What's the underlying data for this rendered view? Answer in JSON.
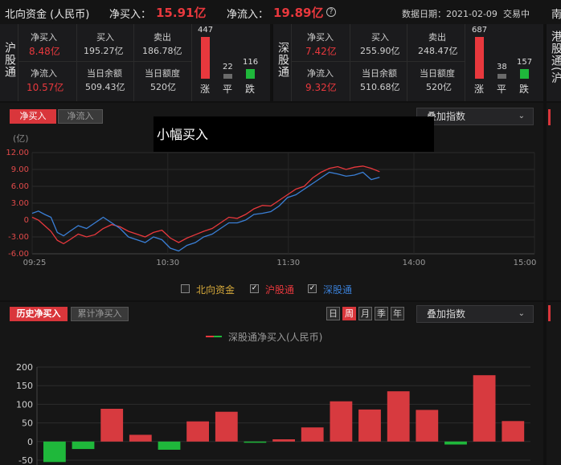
{
  "header": {
    "title": "北向资金 (人民币)",
    "net_buy_label": "净买入：",
    "net_buy_value": "15.91亿",
    "net_inflow_label": "净流入：",
    "net_inflow_value": "19.89亿",
    "help_icon": "?",
    "date_label": "数据日期：2021-02-09",
    "trade_label": "交易中",
    "right_edge": "南"
  },
  "hu": {
    "name": "沪股通",
    "net_buy_label": "净买入",
    "net_buy": "8.48亿",
    "buy_label": "买入",
    "buy": "195.27亿",
    "sell_label": "卖出",
    "sell": "186.78亿",
    "net_inflow_label": "净流入",
    "net_inflow": "10.57亿",
    "balance_label": "当日余额",
    "balance": "509.43亿",
    "quota_label": "当日额度",
    "quota": "520亿",
    "up": "447",
    "flat": "22",
    "down": "116",
    "up_label": "涨",
    "flat_label": "平",
    "down_label": "跌"
  },
  "shen": {
    "name": "深股通",
    "net_buy_label": "净买入",
    "net_buy": "7.42亿",
    "buy_label": "买入",
    "buy": "255.90亿",
    "sell_label": "卖出",
    "sell": "248.47亿",
    "net_inflow_label": "净流入",
    "net_inflow": "9.32亿",
    "balance_label": "当日余额",
    "balance": "510.68亿",
    "quota_label": "当日额度",
    "quota": "520亿",
    "up": "687",
    "flat": "38",
    "down": "157",
    "up_label": "涨",
    "flat_label": "平",
    "down_label": "跌"
  },
  "right_partial": {
    "name": "港股通(沪"
  },
  "intraday": {
    "tab_net_buy": "净买入",
    "tab_net_inflow": "净流入",
    "overlay_select": "叠加指数",
    "tooltip": "小幅买入",
    "unit": "(亿)",
    "legend": {
      "north": "北向资金",
      "hu": "沪股通",
      "shen": "深股通"
    }
  },
  "history": {
    "tab_history": "历史净买入",
    "tab_cumulative": "累计净买入",
    "periods": [
      "日",
      "周",
      "月",
      "季",
      "年"
    ],
    "active_period": "周",
    "overlay_select": "叠加指数",
    "legend_label": "深股通净买入(人民币)"
  },
  "colors": {
    "up": "#e8383d",
    "down": "#1fb83b",
    "hu_line": "#e8383d",
    "shen_line": "#3a7fd6"
  },
  "chart_data": [
    {
      "type": "line",
      "x_ticks": [
        "09:25",
        "10:30",
        "11:30",
        "14:00",
        "15:00"
      ],
      "y_ticks": [
        "12.00",
        "9.00",
        "6.00",
        "3.00",
        "0",
        "-3.00",
        "-6.00"
      ],
      "ylim": [
        -6,
        12
      ],
      "ylabel": "(亿)",
      "grid": true,
      "series": [
        {
          "name": "沪股通",
          "color": "#e8383d",
          "points": [
            [
              0,
              0.5
            ],
            [
              3,
              0
            ],
            [
              6,
              -1
            ],
            [
              9,
              -2
            ],
            [
              12,
              -3.6
            ],
            [
              15,
              -4.2
            ],
            [
              18,
              -3.5
            ],
            [
              22,
              -2.5
            ],
            [
              26,
              -3
            ],
            [
              30,
              -2.6
            ],
            [
              34,
              -1.5
            ],
            [
              38,
              -0.8
            ],
            [
              42,
              -1.2
            ],
            [
              46,
              -2
            ],
            [
              50,
              -2.5
            ],
            [
              54,
              -3
            ],
            [
              58,
              -2.2
            ],
            [
              62,
              -1.8
            ],
            [
              66,
              -3.2
            ],
            [
              70,
              -4
            ],
            [
              74,
              -3.2
            ],
            [
              78,
              -2.6
            ],
            [
              82,
              -2
            ],
            [
              86,
              -1.5
            ],
            [
              90,
              -0.5
            ],
            [
              94,
              0.5
            ],
            [
              98,
              0.3
            ],
            [
              102,
              1
            ],
            [
              106,
              2
            ],
            [
              110,
              2.6
            ],
            [
              114,
              2.5
            ],
            [
              118,
              3.5
            ],
            [
              122,
              4.5
            ],
            [
              126,
              5.5
            ],
            [
              130,
              6
            ],
            [
              134,
              7.5
            ],
            [
              138,
              8.5
            ],
            [
              142,
              9.2
            ],
            [
              146,
              9.5
            ],
            [
              150,
              9
            ],
            [
              154,
              9.4
            ],
            [
              158,
              9.6
            ],
            [
              162,
              9.2
            ],
            [
              166,
              8.6
            ]
          ]
        },
        {
          "name": "深股通",
          "color": "#3a7fd6",
          "points": [
            [
              0,
              1.2
            ],
            [
              3,
              1.6
            ],
            [
              6,
              1
            ],
            [
              9,
              0.5
            ],
            [
              12,
              -2.2
            ],
            [
              15,
              -2.8
            ],
            [
              18,
              -2
            ],
            [
              22,
              -1
            ],
            [
              26,
              -1.5
            ],
            [
              30,
              -0.5
            ],
            [
              34,
              0.5
            ],
            [
              38,
              -0.5
            ],
            [
              42,
              -1.5
            ],
            [
              46,
              -3
            ],
            [
              50,
              -3.5
            ],
            [
              54,
              -4
            ],
            [
              58,
              -3
            ],
            [
              62,
              -3.5
            ],
            [
              66,
              -5
            ],
            [
              70,
              -5.5
            ],
            [
              74,
              -4.5
            ],
            [
              78,
              -4
            ],
            [
              82,
              -3
            ],
            [
              86,
              -2.5
            ],
            [
              90,
              -1.5
            ],
            [
              94,
              -0.5
            ],
            [
              98,
              -0.5
            ],
            [
              102,
              0
            ],
            [
              106,
              1
            ],
            [
              110,
              1.2
            ],
            [
              114,
              1.5
            ],
            [
              118,
              2.5
            ],
            [
              122,
              4
            ],
            [
              126,
              4.5
            ],
            [
              130,
              5.5
            ],
            [
              134,
              6.5
            ],
            [
              138,
              7.5
            ],
            [
              142,
              8.5
            ],
            [
              146,
              8.2
            ],
            [
              150,
              7.8
            ],
            [
              154,
              8
            ],
            [
              158,
              8.5
            ],
            [
              162,
              7.2
            ],
            [
              166,
              7.6
            ]
          ]
        }
      ]
    },
    {
      "type": "bar",
      "title": "深股通净买入(人民币)",
      "ylim": [
        -50,
        200
      ],
      "y_ticks": [
        "200",
        "150",
        "100",
        "50",
        "0",
        "-50"
      ],
      "values": [
        -55,
        -20,
        88,
        18,
        -22,
        54,
        80,
        -3,
        6,
        38,
        108,
        86,
        135,
        85,
        -8,
        178,
        55
      ]
    }
  ]
}
